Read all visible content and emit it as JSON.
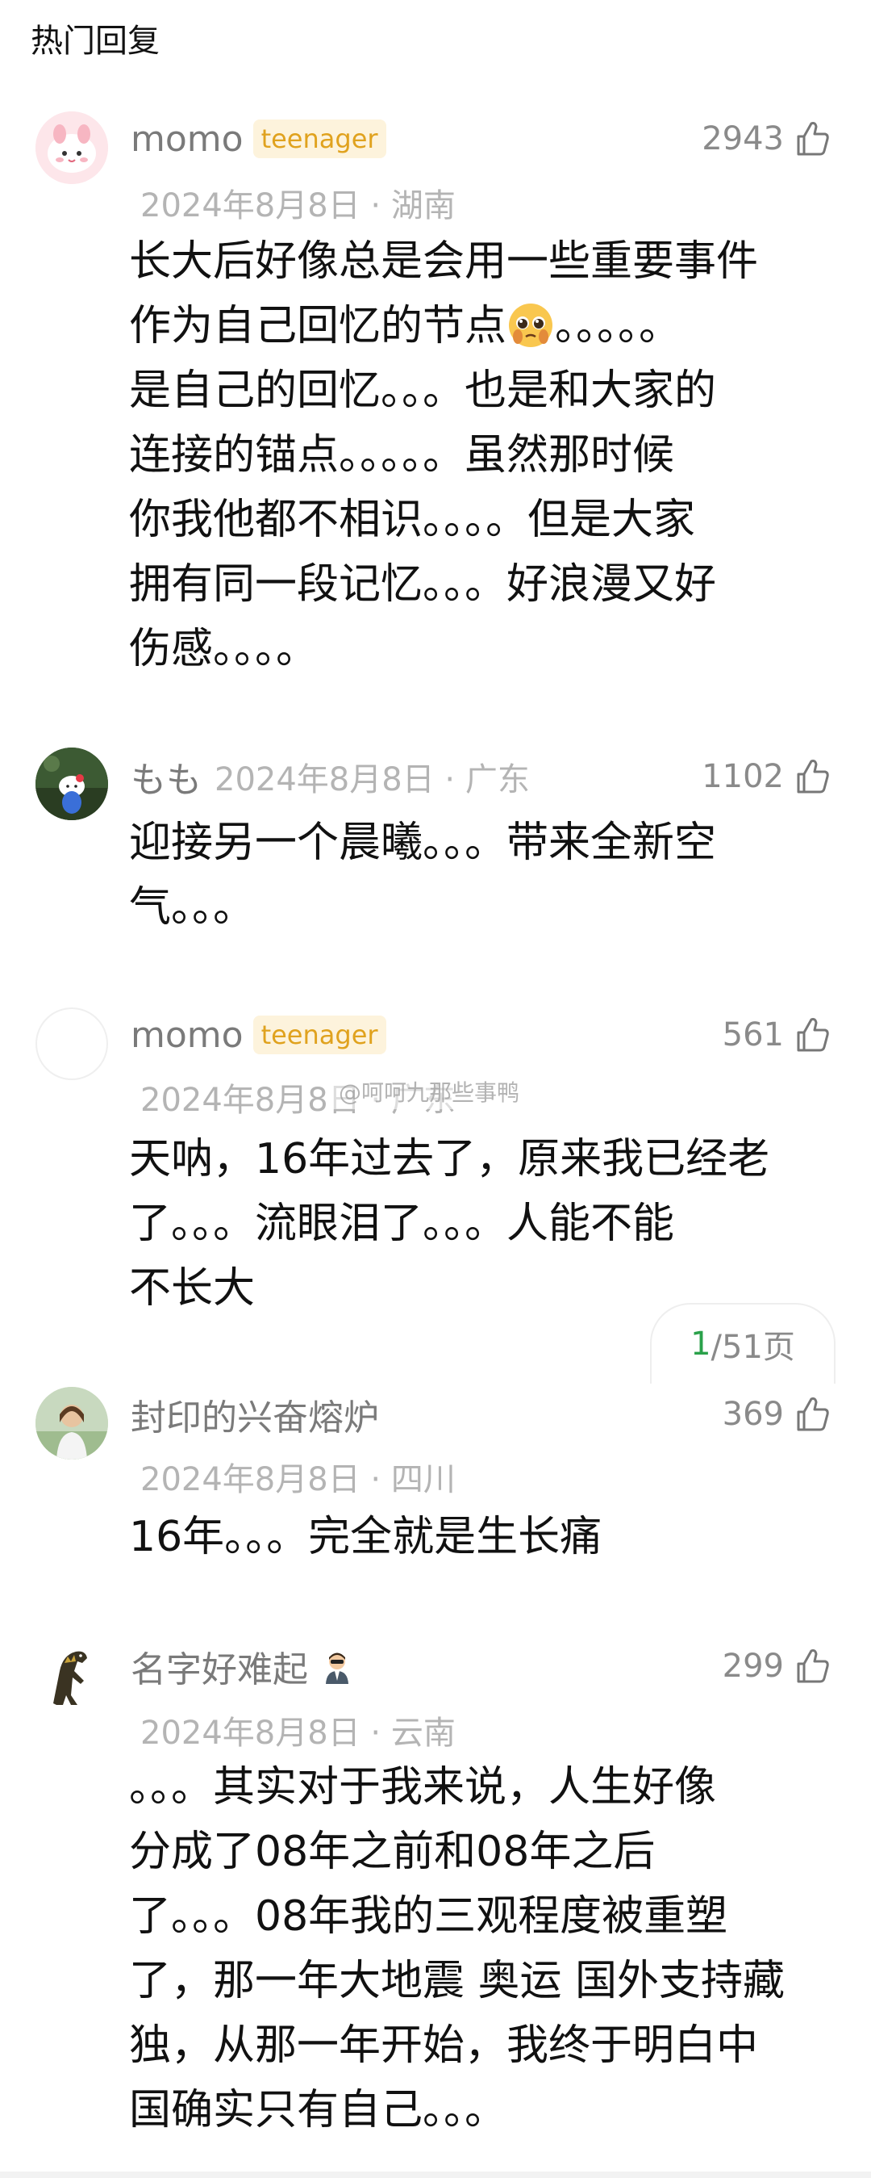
{
  "section_title": "热门回复",
  "comments": [
    {
      "username": "momo",
      "badge": "teenager",
      "date_location": "2024年8月8日 · 湖南",
      "likes": "2943",
      "lines": [
        "长大后好像总是会用一些重要事件",
        "作为自己回忆的节点",
        "是自己的回忆。。。也是和大家的",
        "连接的锚点。。。。。虽然那时候",
        "你我他都不相识。。。。但是大家",
        "拥有同一段记忆。。。好浪漫又好",
        "伤感。。。。"
      ],
      "emoji_suffix": "。。。。。"
    },
    {
      "username": "もも",
      "date_location": "2024年8月8日 · 广东",
      "likes": "1102",
      "lines": [
        "迎接另一个晨曦。。。带来全新空",
        "气。。。"
      ]
    },
    {
      "username": "momo",
      "badge": "teenager",
      "date_location": "2024年8月8日 · 广东",
      "likes": "561",
      "lines": [
        "天呐，16年过去了，原来我已经老",
        "了。。。流眼泪了。。。人能不能",
        "不长大"
      ]
    },
    {
      "username": "封印的兴奋熔炉",
      "date_location": "2024年8月8日 · 四川",
      "likes": "369",
      "lines": [
        "16年。。。完全就是生长痛"
      ]
    },
    {
      "username": "名字好难起",
      "date_location": "2024年8月8日 · 云南",
      "likes": "299",
      "lines": [
        "。。。其实对于我来说，人生好像",
        "分成了08年之前和08年之后",
        "了。。。08年我的三观程度被重塑",
        "了，那一年大地震 奥运 国外支持藏",
        "独，从那一年开始，我终于明白中",
        "国确实只有自己。。。"
      ]
    }
  ],
  "pager": {
    "current": "1",
    "total": "/51页"
  },
  "watermark": "@呵呵九那些事鸭",
  "icons": {
    "like": "thumbs-up-icon",
    "avatar_1": "pink-cat-avatar",
    "avatar_2": "hello-kitty-avatar",
    "avatar_4": "person-photo-avatar",
    "avatar_5": "dinosaur-avatar",
    "badge_icon_5": "man-emoji-icon",
    "pleading_emoji": "pleading-face-icon"
  },
  "colors": {
    "badge_text": "#e0a21e",
    "badge_bg": "#fdf3dc",
    "pager_current": "#2aa14a"
  }
}
